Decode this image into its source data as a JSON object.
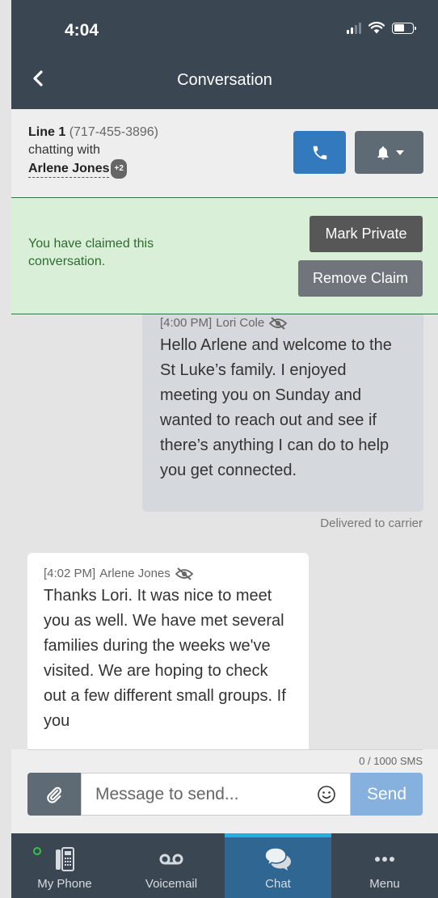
{
  "status_bar": {
    "time": "4:04"
  },
  "nav": {
    "title": "Conversation"
  },
  "line_header": {
    "line_label": "Line 1",
    "line_phone": "(717-455-3896)",
    "chatting_with": "chatting with",
    "contact_name": "Arlene Jones",
    "contact_badge": "+2"
  },
  "claim_banner": {
    "message": "You have claimed this conversation.",
    "mark_private_label": "Mark Private",
    "remove_claim_label": "Remove Claim"
  },
  "messages": [
    {
      "direction": "outgoing",
      "time": "[4:00 PM]",
      "sender": "Lori Cole",
      "text": "Hello Arlene and welcome to the St Luke’s family. I enjoyed meeting you on Sunday and wanted to reach out and see if there’s anything I can do to help you get connected.",
      "status": "Delivered to carrier"
    },
    {
      "direction": "incoming",
      "time": "[4:02 PM]",
      "sender": "Arlene Jones",
      "text": "Thanks Lori. It was nice to meet you as well. We have met several families during the weeks we've visited. We are hoping to check out a few different small groups. If you"
    }
  ],
  "compose": {
    "counter": "0 / 1000 SMS",
    "placeholder": "Message to send...",
    "send_label": "Send"
  },
  "tabs": [
    {
      "label": "My Phone",
      "icon": "desk-phone-icon",
      "active": false
    },
    {
      "label": "Voicemail",
      "icon": "voicemail-icon",
      "active": false
    },
    {
      "label": "Chat",
      "icon": "chat-bubbles-icon",
      "active": true
    },
    {
      "label": "Menu",
      "icon": "more-dots-icon",
      "active": false
    }
  ],
  "colors": {
    "header": "#3a4651",
    "primary": "#3279bd",
    "claim_bg": "#d9efd8",
    "claim_text": "#2e6b2f",
    "active_tab": "#2f6692",
    "active_tab_indicator": "#1fb0e0",
    "send": "#86b1de"
  }
}
